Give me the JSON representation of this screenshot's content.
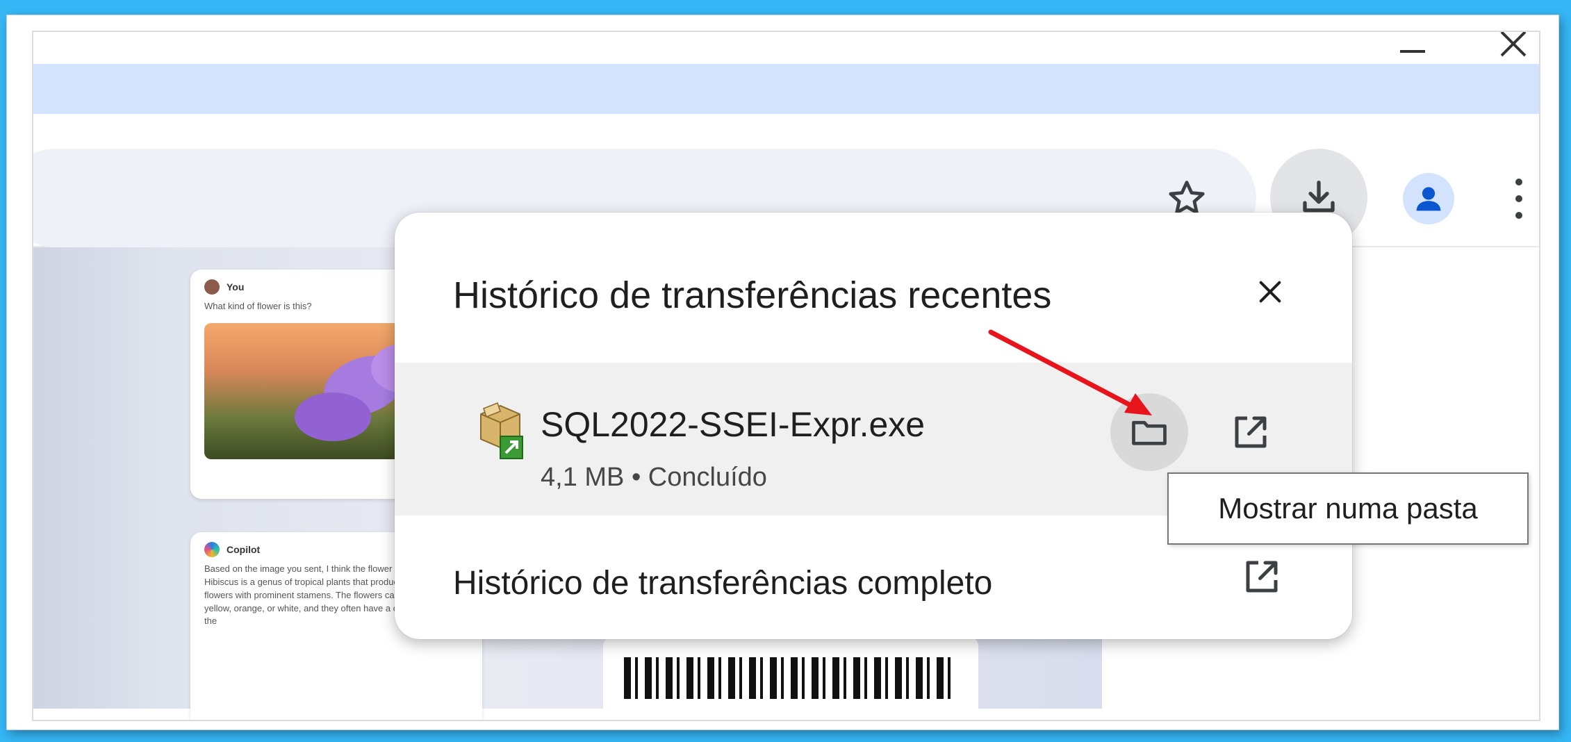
{
  "browser": {
    "toolbar_icons": [
      "star-icon",
      "download-icon",
      "profile-icon",
      "more-vert-icon"
    ]
  },
  "background_page": {
    "card1": {
      "author": "You",
      "message": "What kind of flower is this?"
    },
    "card2": {
      "author": "Copilot",
      "message": "Based on the image you sent, I think the flower is a hibiscus. Hibiscus is a genus of tropical plants that produce large, showy flowers with prominent stamens. The flowers can be pink, red, yellow, orange, or white, and they often have a contrasting eye in the"
    }
  },
  "downloads_popup": {
    "title": "Histórico de transferências recentes",
    "items": [
      {
        "filename": "SQL2022-SSEI-Expr.exe",
        "status": "4,1 MB • Concluído"
      }
    ],
    "full_history_label": "Histórico de transferências completo",
    "tooltip": "Mostrar numa pasta"
  },
  "colors": {
    "accent": "#0b57d0",
    "tabstrip": "#d3e3fd",
    "annotation_arrow": "#e8141b",
    "outer_background": "#35b6f5"
  }
}
